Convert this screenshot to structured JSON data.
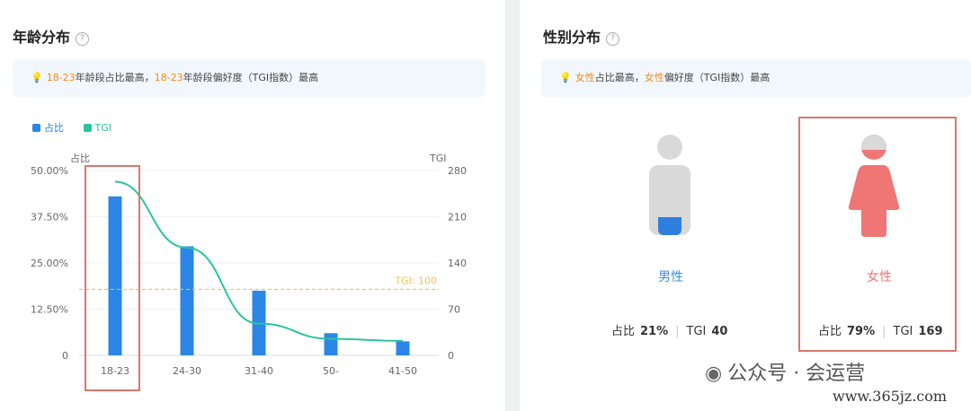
{
  "age": {
    "title": "年龄分布",
    "help_icon": "?",
    "tip": {
      "h1": "18-23",
      "t1": "年龄段占比最高，",
      "h2": "18-23",
      "t2": "年龄段偏好度（TGI指数）最高"
    },
    "legend": [
      {
        "label": "占比",
        "color": "#2b86e8"
      },
      {
        "label": "TGI",
        "color": "#2ac3a1"
      }
    ]
  },
  "gender": {
    "title": "性别分布",
    "help_icon": "?",
    "tip": {
      "h1": "女性",
      "t1": "占比最高，",
      "h2": "女性",
      "t2": "偏好度（TGI指数）最高"
    },
    "male": {
      "label": "男性",
      "share_label": "占比",
      "share": "21%",
      "tgi_label": "TGI",
      "tgi": "40",
      "color": "#3a8ee6"
    },
    "female": {
      "label": "女性",
      "share_label": "占比",
      "share": "79%",
      "tgi_label": "TGI",
      "tgi": "169",
      "color": "#f07575"
    }
  },
  "watermark": {
    "line1": "公众号 · 会运营",
    "line2": "www.365jz.com"
  },
  "chart_data": {
    "type": "bar",
    "categories": [
      "18-23",
      "24-30",
      "31-40",
      "50-",
      "41-50"
    ],
    "series": [
      {
        "name": "占比",
        "type": "bar",
        "values": [
          43.0,
          29.5,
          17.5,
          6.0,
          3.8
        ],
        "color": "#2b86e8"
      },
      {
        "name": "TGI",
        "type": "line",
        "values": [
          263,
          163,
          48,
          25,
          22
        ],
        "color": "#2ac3a1"
      }
    ],
    "ylabel": "占比",
    "ylabel_right": "TGI",
    "ylim": [
      0,
      50
    ],
    "ylim_right": [
      0,
      280
    ],
    "yticks": [
      "0",
      "12.50%",
      "25.00%",
      "37.50%",
      "50.00%"
    ],
    "yticks_right": [
      "0",
      "70",
      "140",
      "210",
      "280"
    ],
    "reference_line": {
      "label": "TGI: 100",
      "value": 100,
      "color": "#f5c04a"
    }
  }
}
